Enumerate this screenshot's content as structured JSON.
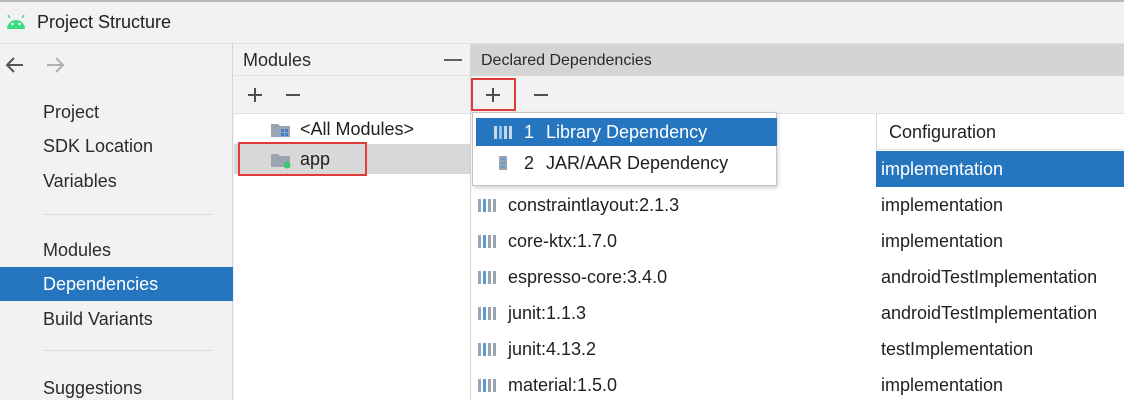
{
  "window": {
    "title": "Project Structure",
    "icon": "android-icon"
  },
  "sidebar": {
    "items": [
      {
        "label": "Project"
      },
      {
        "label": "SDK Location"
      },
      {
        "label": "Variables"
      },
      {
        "label": "Modules"
      },
      {
        "label": "Dependencies",
        "selected": true
      },
      {
        "label": "Build Variants"
      },
      {
        "label": "Suggestions"
      }
    ]
  },
  "modules": {
    "header": "Modules",
    "items": [
      {
        "label": "<All Modules>",
        "icon": "all-modules-folder-icon"
      },
      {
        "label": "app",
        "icon": "module-folder-icon",
        "selected": true
      }
    ]
  },
  "dependencies": {
    "header": "Declared Dependencies",
    "column_configuration": "Configuration",
    "rows": [
      {
        "name": "",
        "configuration": "implementation",
        "selected": true
      },
      {
        "name": "constraintlayout:2.1.3",
        "configuration": "implementation"
      },
      {
        "name": "core-ktx:1.7.0",
        "configuration": "implementation"
      },
      {
        "name": "espresso-core:3.4.0",
        "configuration": "androidTestImplementation"
      },
      {
        "name": "junit:1.1.3",
        "configuration": "androidTestImplementation"
      },
      {
        "name": "junit:4.13.2",
        "configuration": "testImplementation"
      },
      {
        "name": "material:1.5.0",
        "configuration": "implementation"
      }
    ]
  },
  "popup_menu": {
    "items": [
      {
        "number": "1",
        "label": "Library Dependency",
        "icon": "library-icon",
        "selected": true
      },
      {
        "number": "2",
        "label": "JAR/AAR Dependency",
        "icon": "jar-icon"
      }
    ]
  },
  "colors": {
    "accent": "#2675bf",
    "highlight": "#e03a3a",
    "library_icon": "#5b9bd5"
  }
}
